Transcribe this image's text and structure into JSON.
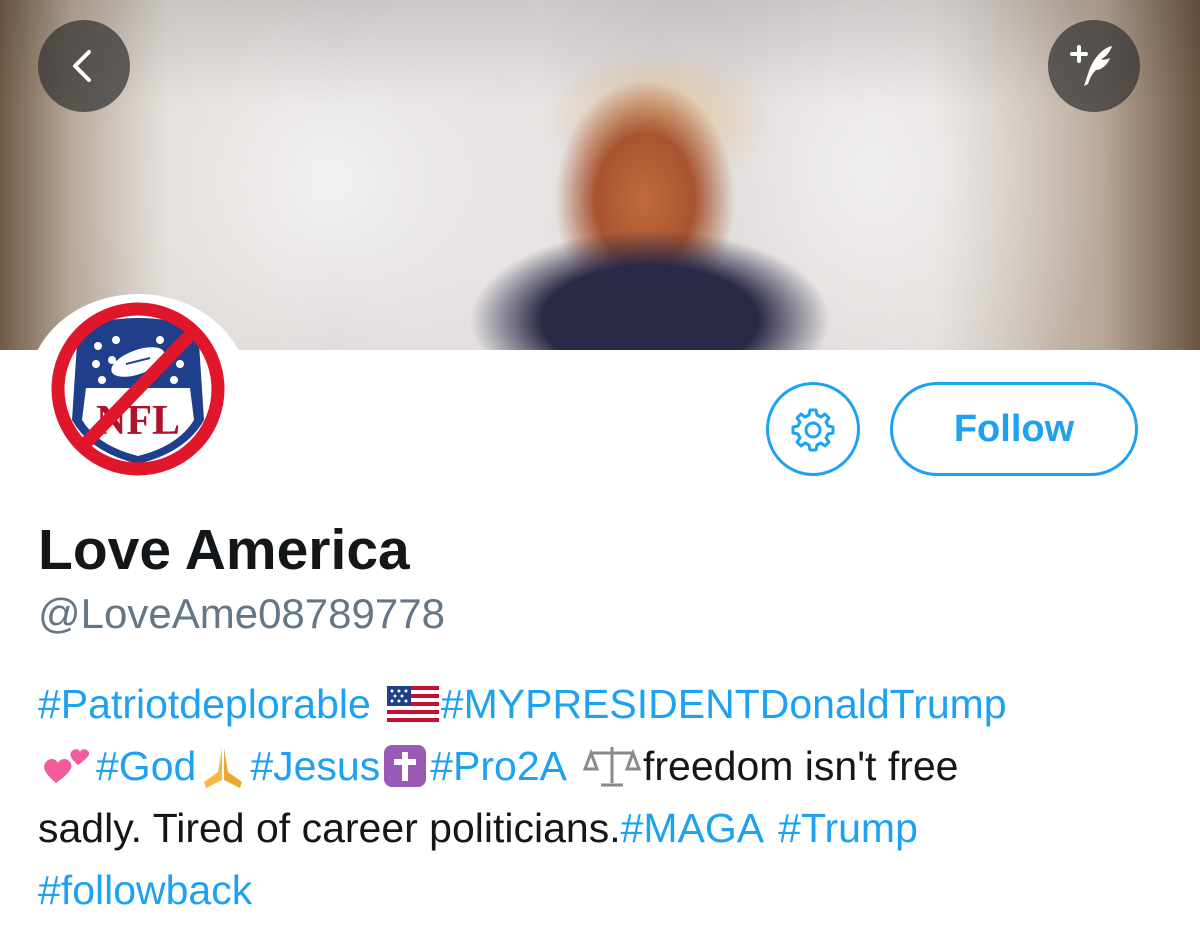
{
  "header": {
    "back_icon": "chevron-left-icon",
    "compose_icon": "compose-tweet-icon"
  },
  "profile": {
    "avatar_text": "NFL",
    "settings_icon": "gear-icon",
    "follow_label": "Follow",
    "name": "Love America",
    "handle": "@LoveAme08789778"
  },
  "bio": {
    "line1": {
      "tag1": "#Patriotdeplorable",
      "emoji1": "us-flag-emoji",
      "tag2": "#MYPRESIDENTDonaldTrump"
    },
    "line2": {
      "emoji1": "two-hearts-emoji",
      "tag1": "#God",
      "emoji2": "praying-hands-emoji",
      "tag2": "#Jesus",
      "emoji3": "latin-cross-emoji",
      "tag3": "#Pro2A",
      "emoji4": "scales-emoji",
      "text": "freedom isn't free"
    },
    "line3": {
      "text": "sadly. Tired of career politicians.",
      "tag1": "#MAGA",
      "tag2": "#Trump"
    },
    "line4": {
      "tag1": "#followback"
    }
  },
  "colors": {
    "accent": "#1da1f2",
    "text": "#14171a",
    "secondary_text": "#657786"
  }
}
